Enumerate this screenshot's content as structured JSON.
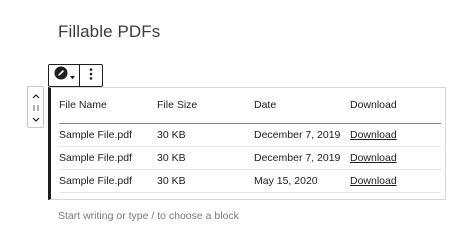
{
  "page": {
    "title": "Fillable PDFs"
  },
  "toolbar": {
    "block_icon": "pen-icon",
    "more_icon": "vertical-ellipsis-icon"
  },
  "mover": {
    "up_icon": "chevron-up-icon",
    "drag_icon": "drag-handle-icon",
    "down_icon": "chevron-down-icon"
  },
  "table": {
    "headers": [
      "File Name",
      "File Size",
      "Date",
      "Download"
    ],
    "rows": [
      {
        "file_name": "Sample File.pdf",
        "file_size": "30 KB",
        "date": "December 7, 2019",
        "download": "Download"
      },
      {
        "file_name": "Sample File.pdf",
        "file_size": "30 KB",
        "date": "December 7, 2019",
        "download": "Download"
      },
      {
        "file_name": "Sample File.pdf",
        "file_size": "30 KB",
        "date": "May 15, 2020",
        "download": "Download"
      }
    ]
  },
  "appender": {
    "placeholder": "Start writing or type / to choose a block"
  }
}
